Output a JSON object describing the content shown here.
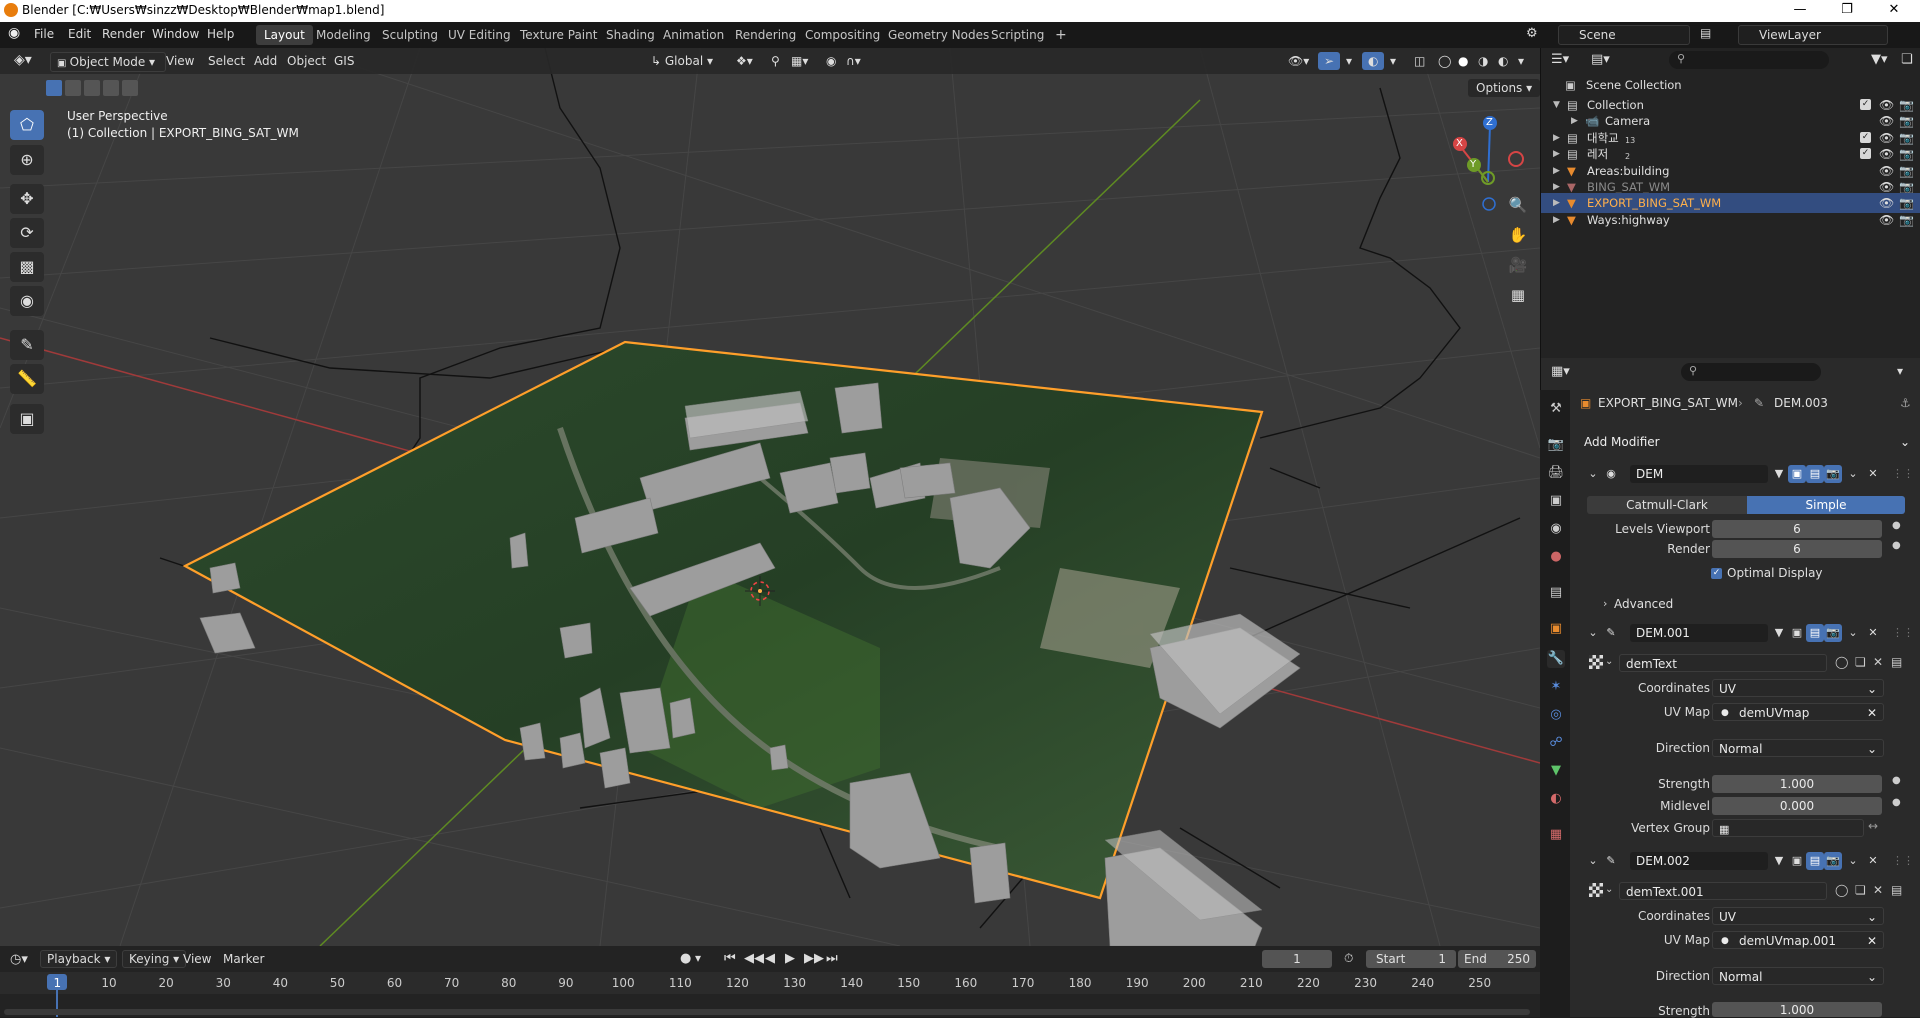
{
  "window": {
    "title": "Blender [C:₩Users₩sinzz₩Desktop₩Blender₩map1.blend]"
  },
  "menu": [
    "File",
    "Edit",
    "Render",
    "Window",
    "Help"
  ],
  "workspaces": [
    "Layout",
    "Modeling",
    "Sculpting",
    "UV Editing",
    "Texture Paint",
    "Shading",
    "Animation",
    "Rendering",
    "Compositing",
    "Geometry Nodes",
    "Scripting",
    "+"
  ],
  "active_workspace": "Layout",
  "scene": {
    "name": "Scene",
    "view_layer": "ViewLayer"
  },
  "viewport_header": {
    "mode": "Object Mode",
    "menus": [
      "View",
      "Select",
      "Add",
      "Object",
      "GIS"
    ],
    "orientation": "Global",
    "options_label": "Options"
  },
  "viewport": {
    "perspective": "User Perspective",
    "collection_info": "(1) Collection | EXPORT_BING_SAT_WM",
    "gizmo": {
      "x": "X",
      "y": "Y",
      "z": "Z"
    }
  },
  "timeline": {
    "menus": [
      "Playback",
      "Keying",
      "View",
      "Marker"
    ],
    "current_frame": "1",
    "start_label": "Start",
    "start": "1",
    "end_label": "End",
    "end": "250",
    "ruler": [
      "1",
      "10",
      "20",
      "30",
      "40",
      "50",
      "60",
      "70",
      "80",
      "90",
      "100",
      "110",
      "120",
      "130",
      "140",
      "150",
      "160",
      "170",
      "180",
      "190",
      "200",
      "210",
      "220",
      "230",
      "240",
      "250"
    ]
  },
  "outliner": {
    "root": "Scene Collection",
    "items": [
      {
        "label": "Collection",
        "badge": "",
        "selected": false
      },
      {
        "label": "Camera",
        "badge": "",
        "selected": false
      },
      {
        "label": "대학교",
        "badge": "13",
        "selected": false
      },
      {
        "label": "레저",
        "badge": "2",
        "selected": false
      },
      {
        "label": "Areas:building",
        "badge": "",
        "selected": false
      },
      {
        "label": "BING_SAT_WM",
        "badge": "",
        "selected": false
      },
      {
        "label": "EXPORT_BING_SAT_WM",
        "badge": "",
        "selected": true
      },
      {
        "label": "Ways:highway",
        "badge": "",
        "selected": false
      }
    ]
  },
  "properties": {
    "object": "EXPORT_BING_SAT_WM",
    "data": "DEM.003",
    "add_modifier": "Add Modifier",
    "mod1": {
      "name": "DEM",
      "catmull": "Catmull-Clark",
      "simple": "Simple",
      "levels_label": "Levels Viewport",
      "levels": "6",
      "render_label": "Render",
      "render": "6",
      "optimal": "Optimal Display",
      "advanced": "Advanced"
    },
    "mod2": {
      "name": "DEM.001",
      "texture": "demText",
      "coords_label": "Coordinates",
      "coords": "UV",
      "uvmap_label": "UV Map",
      "uvmap": "demUVmap",
      "direction_label": "Direction",
      "direction": "Normal",
      "strength_label": "Strength",
      "strength": "1.000",
      "midlevel_label": "Midlevel",
      "midlevel": "0.000",
      "vgroup_label": "Vertex Group"
    },
    "mod3": {
      "name": "DEM.002",
      "texture": "demText.001",
      "coords_label": "Coordinates",
      "coords": "UV",
      "uvmap_label": "UV Map",
      "uvmap": "demUVmap.001",
      "direction_label": "Direction",
      "direction": "Normal",
      "strength_label": "Strength",
      "strength": "1.000"
    }
  },
  "colors": {
    "accent": "#4772b3",
    "selection": "#ff9f2a",
    "x_axis": "#d64545",
    "y_axis": "#6e9b27",
    "z_axis": "#2f6fd1"
  }
}
